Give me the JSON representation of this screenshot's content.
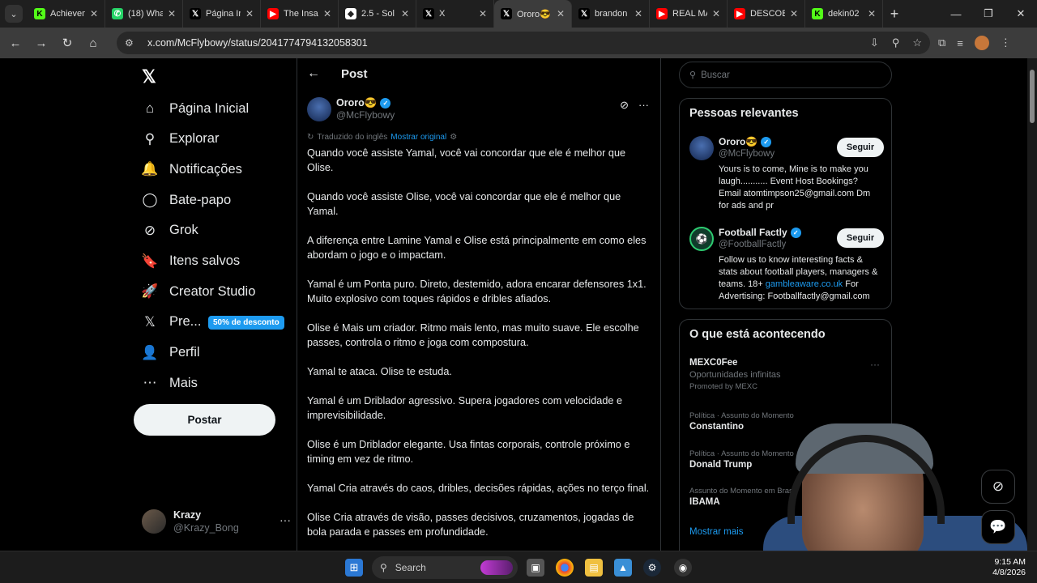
{
  "browser": {
    "tabs": [
      {
        "label": "Achievem",
        "icon": "kick-icon",
        "color": "#53fc18",
        "glyph": "K"
      },
      {
        "label": "(18) Wha",
        "icon": "whatsapp-icon",
        "color": "#25d366",
        "glyph": "✆"
      },
      {
        "label": "Página Ir",
        "icon": "x-icon",
        "color": "#000000",
        "glyph": "𝕏"
      },
      {
        "label": "The Insa",
        "icon": "youtube-icon",
        "color": "#ff0000",
        "glyph": "▶"
      },
      {
        "label": "2.5 - Sol",
        "icon": "shield-icon",
        "color": "#ffffff",
        "glyph": "◆"
      },
      {
        "label": "X",
        "icon": "x-icon",
        "color": "#000000",
        "glyph": "𝕏"
      },
      {
        "label": "Ororo😎",
        "icon": "x-icon",
        "color": "#000000",
        "glyph": "𝕏",
        "active": true
      },
      {
        "label": "brandon",
        "icon": "x-icon",
        "color": "#000000",
        "glyph": "𝕏"
      },
      {
        "label": "REAL MA",
        "icon": "youtube-icon",
        "color": "#ff0000",
        "glyph": "▶"
      },
      {
        "label": "DESCOB",
        "icon": "youtube-icon",
        "color": "#ff0000",
        "glyph": "▶"
      },
      {
        "label": "dekin02",
        "icon": "kick-icon",
        "color": "#53fc18",
        "glyph": "K"
      }
    ],
    "url": "x.com/McFlybowy/status/2041774794132058301"
  },
  "nav": {
    "items": [
      {
        "label": "Página Inicial",
        "icon": "home-icon",
        "glyph": "⌂"
      },
      {
        "label": "Explorar",
        "icon": "search-icon",
        "glyph": "⚲"
      },
      {
        "label": "Notificações",
        "icon": "bell-icon",
        "glyph": "🔔"
      },
      {
        "label": "Bate-papo",
        "icon": "chat-icon",
        "glyph": "◯"
      },
      {
        "label": "Grok",
        "icon": "grok-icon",
        "glyph": "⊘"
      },
      {
        "label": "Itens salvos",
        "icon": "bookmark-icon",
        "glyph": "🔖"
      },
      {
        "label": "Creator Studio",
        "icon": "rocket-icon",
        "glyph": "🚀"
      },
      {
        "label": "Pre...",
        "icon": "x-icon",
        "glyph": "𝕏"
      },
      {
        "label": "Perfil",
        "icon": "person-icon",
        "glyph": "👤"
      },
      {
        "label": "Mais",
        "icon": "more-circle-icon",
        "glyph": "⋯"
      }
    ],
    "premium_badge": "50% de desconto",
    "post_button": "Postar",
    "account": {
      "name": "Krazy",
      "handle": "@Krazy_Bong"
    }
  },
  "post": {
    "header": "Post",
    "author": {
      "name": "Ororo😎",
      "handle": "@McFlybowy"
    },
    "translated_label": "Traduzido do inglês",
    "show_original": "Mostrar original",
    "paragraphs": [
      "Quando você assiste Yamal, você vai concordar que ele é melhor que Olise.",
      "Quando você assiste Olise, você vai concordar que ele é melhor que Yamal.",
      "A diferença entre Lamine Yamal e Olise está principalmente em como eles abordam o jogo e o impactam.",
      "Yamal é um Ponta puro. Direto, destemido, adora encarar defensores 1x1. Muito explosivo com toques rápidos e dribles afiados.",
      "Olise é Mais um criador. Ritmo mais lento, mas muito suave. Ele escolhe passes, controla o ritmo e joga com compostura.",
      "Yamal te ataca. Olise te estuda.",
      "Yamal é um Driblador agressivo. Supera jogadores com velocidade e imprevisibilidade.",
      "Olise é um Driblador elegante. Usa fintas corporais, controle próximo e timing em vez de ritmo.",
      "Yamal Cria através do caos, dribles, decisões rápidas, ações no terço final.",
      "Olise Cria através de visão, passes decisivos, cruzamentos, jogadas de bola parada e passes em profundidade."
    ]
  },
  "sidebar": {
    "search_placeholder": "Buscar",
    "relevant_title": "Pessoas relevantes",
    "people": [
      {
        "name": "Ororo😎",
        "handle": "@McFlybowy",
        "bio": "Yours is to come, Mine is to make you laugh........... Event Host Bookings? Email atomtimpson25@gmail.com Dm for ads and pr",
        "follow": "Seguir"
      },
      {
        "name": "Football Factly",
        "handle": "@FootballFactly",
        "bio_pre": "Follow us to know interesting facts & stats about football players, managers & teams. 18+ ",
        "bio_link": "gambleaware.co.uk",
        "bio_post": " For Advertising: Footballfactly@gmail.com",
        "follow": "Seguir"
      }
    ],
    "trending_title": "O que está acontecendo",
    "trends": [
      {
        "title": "MEXC0Fee",
        "sub": "Oportunidades infinitas",
        "promo": "Promoted by MEXC"
      },
      {
        "context": "Política · Assunto do Momento",
        "title": "Constantino"
      },
      {
        "context": "Política · Assunto do Momento",
        "title": "Donald Trump"
      },
      {
        "context": "Assunto do Momento em Brasil",
        "title": "IBAMA"
      }
    ],
    "show_more": "Mostrar mais"
  },
  "taskbar": {
    "search_label": "Search",
    "time": "9:15 AM",
    "date": "4/8/2026"
  }
}
